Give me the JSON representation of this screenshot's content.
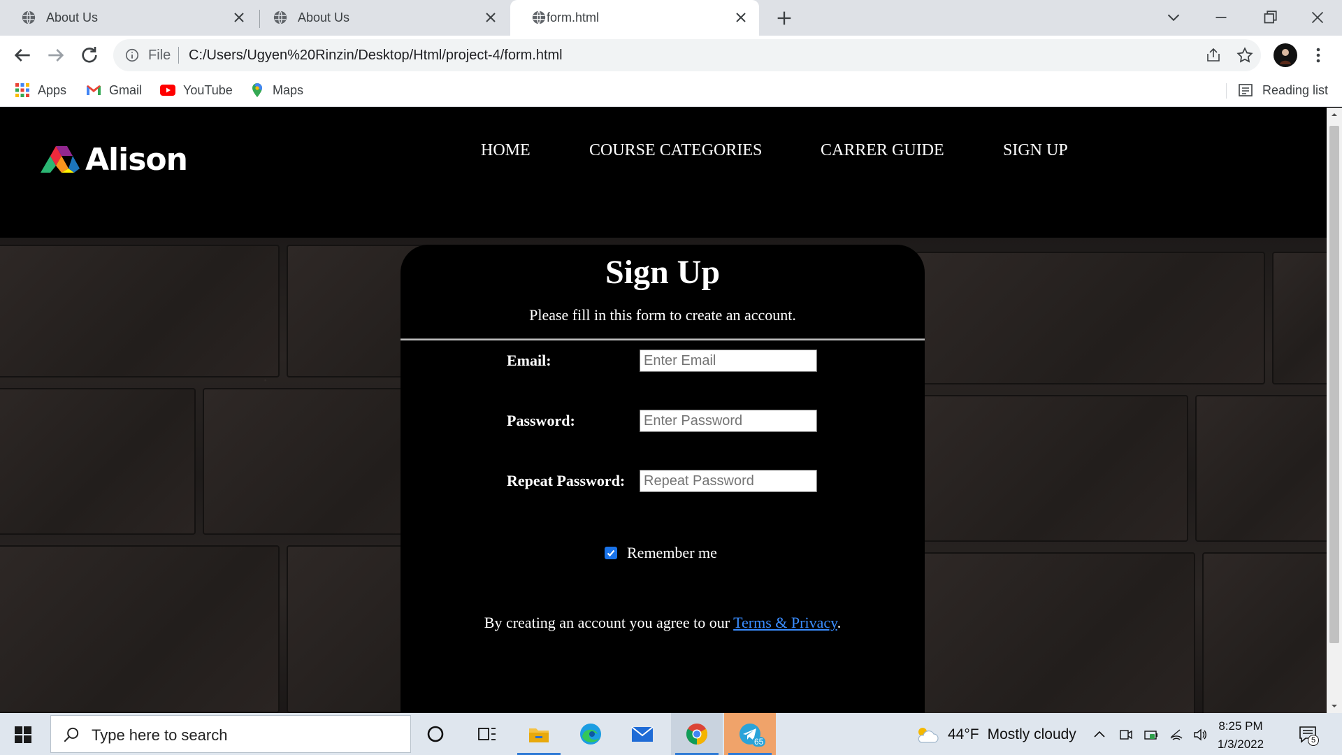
{
  "browser": {
    "tabs": [
      {
        "title": "About Us",
        "active": false
      },
      {
        "title": "About Us",
        "active": false
      },
      {
        "title": "form.html",
        "active": true
      }
    ],
    "address": {
      "scheme_label": "File",
      "url": "C:/Users/Ugyen%20Rinzin/Desktop/Html/project-4/form.html"
    },
    "bookmarks": [
      {
        "label": "Apps",
        "icon": "apps-grid-icon"
      },
      {
        "label": "Gmail",
        "icon": "gmail-icon"
      },
      {
        "label": "YouTube",
        "icon": "youtube-icon"
      },
      {
        "label": "Maps",
        "icon": "maps-icon"
      }
    ],
    "reading_list": "Reading list"
  },
  "site": {
    "logo_text": "Alison",
    "nav": [
      "HOME",
      "COURSE CATEGORIES",
      "CARRER GUIDE",
      "SIGN UP"
    ]
  },
  "form": {
    "title": "Sign Up",
    "subtitle": "Please fill in this form to create an account.",
    "fields": [
      {
        "label": "Email:",
        "placeholder": "Enter Email",
        "value": ""
      },
      {
        "label": "Password:",
        "placeholder": "Enter Password",
        "value": ""
      },
      {
        "label": "Repeat Password:",
        "placeholder": "Repeat Password",
        "value": ""
      }
    ],
    "remember": {
      "label": "Remember me",
      "checked": true
    },
    "terms_prefix": "By creating an account you agree to our ",
    "terms_link": "Terms & Privacy",
    "terms_suffix": "."
  },
  "taskbar": {
    "search_placeholder": "Type here to search",
    "apps": [
      "cortana-icon",
      "task-view-icon",
      "file-explorer-icon",
      "edge-icon",
      "mail-icon",
      "chrome-icon",
      "telegram-icon"
    ],
    "telegram_badge": "65",
    "weather_temp": "44°F",
    "weather_text": "Mostly cloudy",
    "time": "8:25 PM",
    "date": "1/3/2022",
    "notification_count": "5"
  },
  "colors": {
    "accent": "#1a73e8",
    "link": "#3a8dff",
    "header_bg": "#000000",
    "taskbar_bg": "#dfe6ee"
  }
}
